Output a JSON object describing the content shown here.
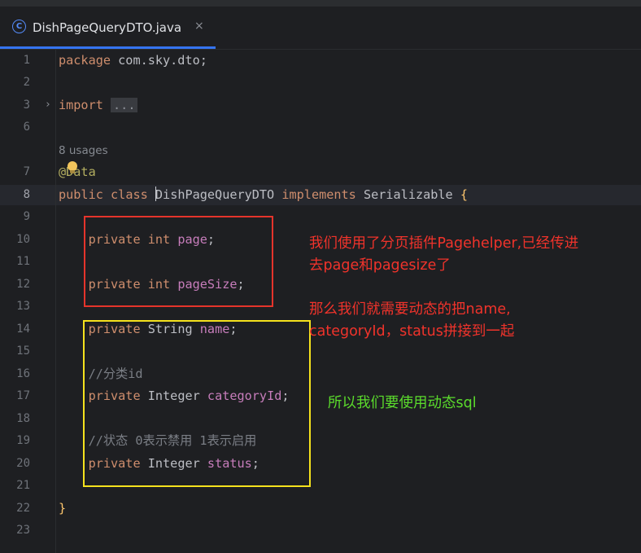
{
  "tab": {
    "icon": "class-c-icon",
    "icon_glyph": "C",
    "label": "DishPageQueryDTO.java",
    "close": "×"
  },
  "editor": {
    "line_numbers": [
      "1",
      "2",
      "3",
      "6",
      "7",
      "8",
      "9",
      "10",
      "11",
      "12",
      "13",
      "14",
      "15",
      "16",
      "17",
      "18",
      "19",
      "20",
      "21",
      "22",
      "23"
    ],
    "current_line": "8",
    "usages": "8 usages",
    "code": {
      "package_kw": "package",
      "package_name": " com.sky.dto;",
      "import_kw": "import",
      "import_collapsed": "...",
      "annotation": "@Data",
      "public_kw": "public",
      "class_kw": "class",
      "class_name": "DishPageQueryDTO",
      "implements_kw": "implements",
      "interface_name": "Serializable",
      "open_brace": "{",
      "close_brace": "}",
      "private_kw": "private",
      "int_type": "int",
      "string_type": "String",
      "integer_type": "Integer",
      "field_page": "page",
      "field_pagesize": "pageSize",
      "field_name": "name",
      "field_categoryid": "categoryId",
      "field_status": "status",
      "semicolon": ";",
      "comment_category": "//分类id",
      "comment_status": "//状态 0表示禁用 1表示启用"
    }
  },
  "annotations": {
    "note1_line1": "我们使用了分页插件Pagehelper,已经传进",
    "note1_line2": "去page和pagesize了",
    "note2_line1": "那么我们就需要动态的把name,",
    "note2_line2": "categoryId，status拼接到一起",
    "note3": "所以我们要使用动态sql",
    "colors": {
      "red_box": "#e5342b",
      "yellow_box": "#f5e21d",
      "red_text": "#f0332b",
      "green_text": "#5bdc2c"
    }
  }
}
